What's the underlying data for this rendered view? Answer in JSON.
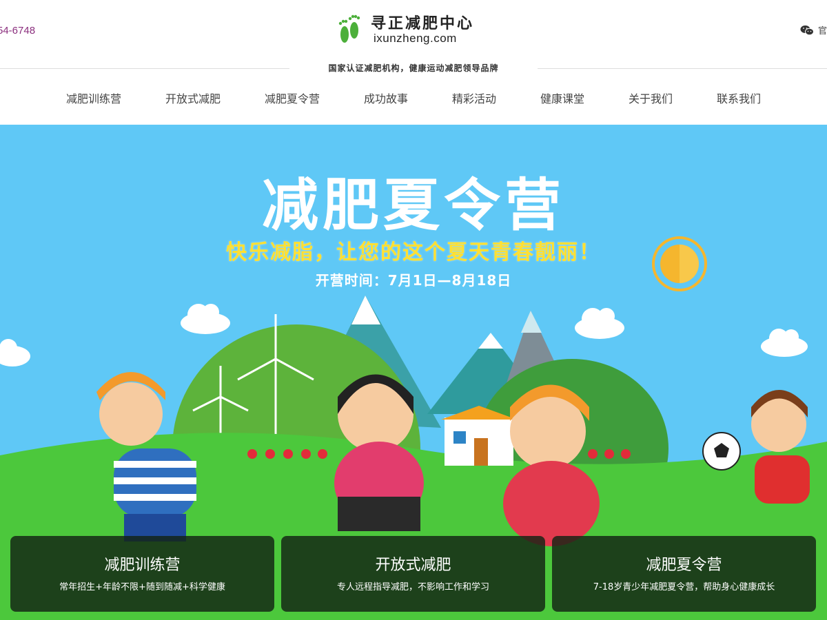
{
  "header": {
    "phone": "54-6748",
    "logo_title": "寻正减肥中心",
    "logo_domain": "ixunzheng.com",
    "wechat_label": "官",
    "slogan": "国家认证减肥机构，健康运动减肥领导品牌"
  },
  "nav": {
    "items": [
      {
        "label": "减肥训练营"
      },
      {
        "label": "开放式减肥"
      },
      {
        "label": "减肥夏令营"
      },
      {
        "label": "成功故事"
      },
      {
        "label": "精彩活动"
      },
      {
        "label": "健康课堂"
      },
      {
        "label": "关于我们"
      },
      {
        "label": "联系我们"
      }
    ]
  },
  "banner": {
    "title": "减肥夏令营",
    "subtitle": "快乐减脂，让您的这个夏天青春靓丽！",
    "date": "开营时间：7月1日—8月18日"
  },
  "cards": [
    {
      "title": "减肥训练营",
      "desc": "常年招生+年龄不限+随到随减+科学健康"
    },
    {
      "title": "开放式减肥",
      "desc": "专人远程指导减肥，不影响工作和学习"
    },
    {
      "title": "减肥夏令营",
      "desc": "7-18岁青少年减肥夏令营，帮助身心健康成长"
    }
  ],
  "colors": {
    "phone": "#8b2f7e",
    "sky": "#5fc8f6",
    "grass": "#4cc83c",
    "subtitle": "#ffe033",
    "logo_green": "#4caf3a"
  },
  "icons": [
    "footprint-logo-icon",
    "wechat-icon",
    "sun-icon",
    "cloud-icon",
    "windmill-icon",
    "soccer-ball-icon"
  ]
}
